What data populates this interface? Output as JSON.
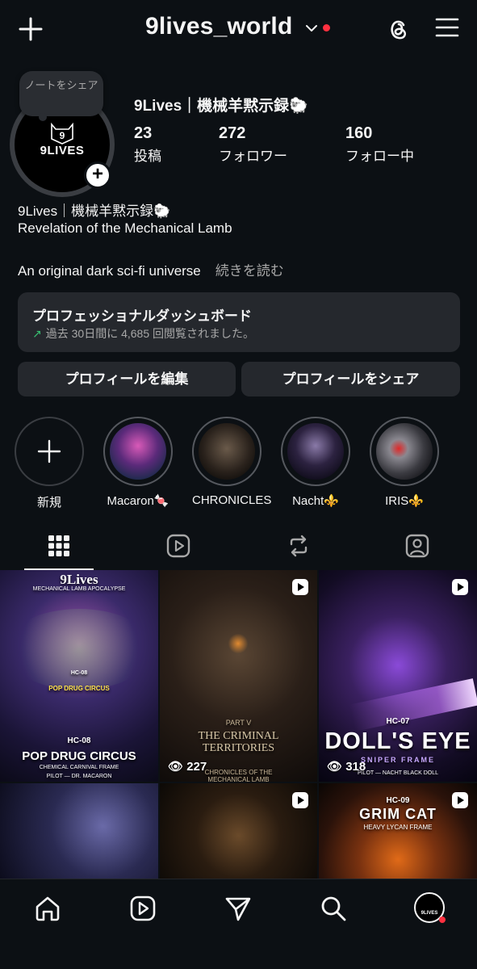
{
  "header": {
    "username": "9lives_world",
    "icons": [
      "plus-icon",
      "chevron-down-icon",
      "threads-icon",
      "hamburger-menu-icon"
    ]
  },
  "profile": {
    "note_bubble": "ノートをシェア",
    "avatar_text": "9LIVES",
    "avatar_badge": "9",
    "display_name": "9Lives｜機械羊黙示録🐑",
    "stats": [
      {
        "value": "23",
        "label": "投稿"
      },
      {
        "value": "272",
        "label": "フォロワー"
      },
      {
        "value": "160",
        "label": "フォロー中"
      }
    ],
    "bio_name": "9Lives｜機械羊黙示録🐑",
    "bio_line": "Revelation of the Mechanical Lamb",
    "bio_desc": "An original dark sci-fi universe",
    "bio_more": "続きを読む"
  },
  "dashboard": {
    "title": "プロフェッショナルダッシュボード",
    "subtitle": "過去 30日間に 4,685 回閲覧されました。",
    "arrow": "↗"
  },
  "buttons": {
    "edit": "プロフィールを編集",
    "share": "プロフィールをシェア"
  },
  "highlights": [
    {
      "label": "新規"
    },
    {
      "label": "Macaron🍬"
    },
    {
      "label": "CHRONICLES"
    },
    {
      "label": "Nacht⚜️"
    },
    {
      "label": "IRIS⚜️"
    }
  ],
  "tabs": [
    "grid-icon",
    "reels-icon",
    "reposts-icon",
    "tagged-icon"
  ],
  "grid": [
    {
      "top": "9Lives",
      "top_sub": "MECHANICAL LAMB APOCALYPSE",
      "code": "HC-08",
      "badge": "POP DRUG CIRCUS",
      "title": "POP DRUG CIRCUS",
      "sub": "CHEMICAL CARNIVAL FRAME",
      "pilot": "PILOT — DR. MACARON"
    },
    {
      "views": "227",
      "part": "PART V",
      "title": "THE CRIMINAL TERRITORIES",
      "sub": "CHRONICLES OF THE MECHANICAL LAMB"
    },
    {
      "views": "318",
      "code": "HC-07",
      "title": "DOLL'S EYE",
      "sub": "SNIPER FRAME",
      "pilot": "PILOT — NACHT  BLACK DOLL"
    },
    {},
    {},
    {
      "code": "HC-09",
      "title": "GRIM CAT",
      "sub": "HEAVY LYCAN FRAME"
    }
  ],
  "bottom_nav": [
    "home-icon",
    "reels-icon",
    "send-icon",
    "search-icon",
    "profile-avatar"
  ],
  "nav_avatar_text": "9LIVES",
  "colors": {
    "background": "#0c1014",
    "card": "#25282d",
    "notification": "#ff3040",
    "trend": "#38c172"
  }
}
